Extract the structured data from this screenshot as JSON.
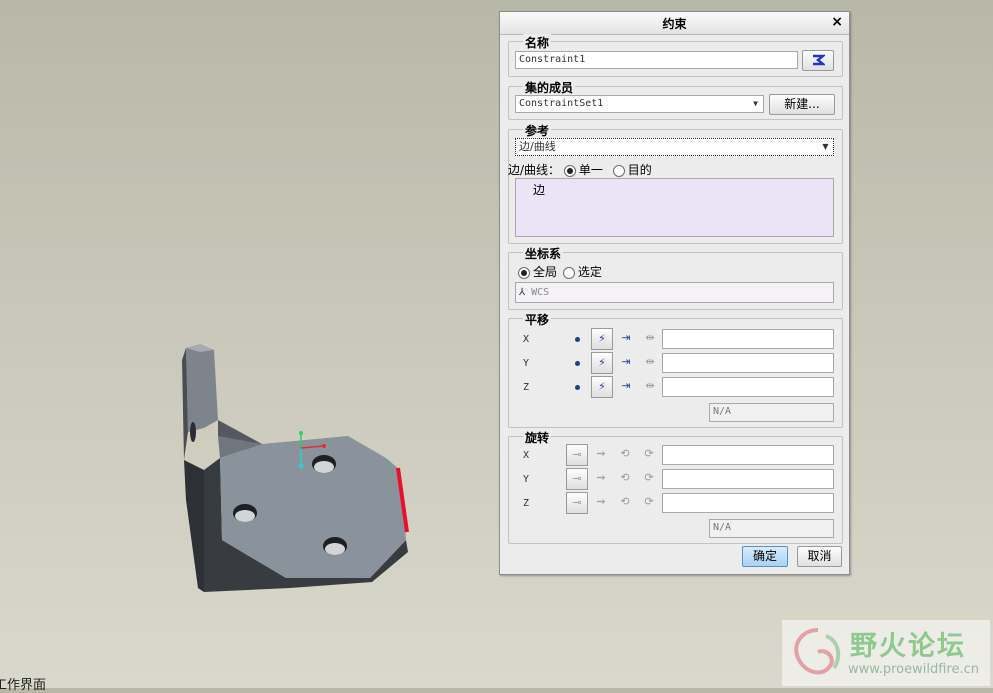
{
  "status_text": "工作界面",
  "dialog": {
    "title": "约束",
    "close_icon": "×",
    "name_group": {
      "label": "名称",
      "value": "Constraint1"
    },
    "member_group": {
      "label": "集的成员",
      "value": "ConstraintSet1",
      "new_button": "新建..."
    },
    "reference_group": {
      "label": "参考",
      "type_value": "边/曲线",
      "mode_label": "边/曲线：",
      "options": [
        "单一",
        "目的"
      ],
      "selected_option": "单一",
      "list_items": [
        "边"
      ]
    },
    "coord_group": {
      "label": "坐标系",
      "options": [
        "全局",
        "选定"
      ],
      "selected_option": "全局",
      "csys_value": "WCS"
    },
    "translation_group": {
      "label": "平移",
      "axes": [
        "X",
        "Y",
        "Z"
      ],
      "summary": "N/A"
    },
    "rotation_group": {
      "label": "旋转",
      "axes": [
        "X",
        "Y",
        "Z"
      ],
      "summary": "N/A"
    },
    "ok_button": "确定",
    "cancel_button": "取消"
  },
  "watermark": {
    "title": "野火论坛",
    "url": "www.proewildfire.cn"
  },
  "colors": {
    "highlight_edge": "#e8102a",
    "part_top": "#8a929b",
    "part_side": "#3c3f44",
    "ok_button": "#a9d2f1"
  }
}
